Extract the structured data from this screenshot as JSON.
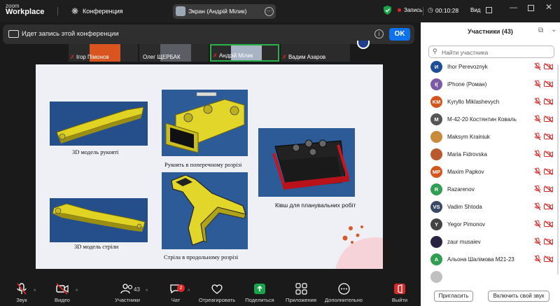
{
  "topbar": {
    "logo_line1": "zoom",
    "logo_line2": "Workplace",
    "conference_label": "Конференция",
    "screen_share_label": "Экран (Андрій Мілик)",
    "record_label": "Запись",
    "timer": "00:10:28",
    "view_label": "Вид"
  },
  "banner": {
    "text": "Идет запись этой конференции",
    "ok_label": "OK"
  },
  "thumbnails": [
    {
      "name": "Ігор Пімонов",
      "muted": true
    },
    {
      "name": "Олег ЩЕРБАК",
      "muted": false
    },
    {
      "name": "Андрій Мілик",
      "muted": true
    },
    {
      "name": "Вадим Азаров",
      "muted": true
    }
  ],
  "slide": {
    "captions": {
      "handle3d": "3D модель рукояті",
      "handle_section": "Рукоять в поперечному розрізі",
      "bucket": "Ківш для планувальних робіт",
      "boom3d": "3D модель стріли",
      "boom_section": "Стріла в продольному розрізі"
    }
  },
  "panel": {
    "title": "Участники (43)",
    "search_placeholder": "Найти участника",
    "invite_label": "Пригласить",
    "unmute_label": "Включить свой звук",
    "participants": [
      {
        "initials": "И",
        "name": "Ihor Perevoznyk",
        "color": "#1f4e99"
      },
      {
        "initials": "I(",
        "name": "iPhone (Роман)",
        "color": "#7a5aa8"
      },
      {
        "initials": "KM",
        "name": "Kyryllo Miklashevych",
        "color": "#d4541e"
      },
      {
        "initials": "M",
        "name": "M-42-20 Костянтин Коваль",
        "color": "#555555"
      },
      {
        "initials": "",
        "name": "Maksym Krainiuk",
        "color": "#c98a3c"
      },
      {
        "initials": "",
        "name": "Maria Fidrovska",
        "color": "#b85a2e"
      },
      {
        "initials": "MP",
        "name": "Maxim Papkov",
        "color": "#d4541e"
      },
      {
        "initials": "R",
        "name": "Razarenov",
        "color": "#2f9e52"
      },
      {
        "initials": "VS",
        "name": "Vadim Shtoda",
        "color": "#3a4a66"
      },
      {
        "initials": "Y",
        "name": "Yegor Pimonov",
        "color": "#444444"
      },
      {
        "initials": "",
        "name": "zaur musaiev",
        "color": "#2a2340"
      },
      {
        "initials": "А",
        "name": "Альона Шалімова М21-23",
        "color": "#2f9e52"
      },
      {
        "initials": "",
        "name": "",
        "color": "#c0c0c0"
      }
    ]
  },
  "toolbar": {
    "audio": "Звук",
    "video": "Видео",
    "participants": "Участники",
    "participants_count": "43",
    "chat": "Чат",
    "chat_badge": "2",
    "react": "Отреагировать",
    "share": "Поделиться",
    "apps": "Приложения",
    "more": "Дополнительно",
    "leave": "Выйти"
  },
  "colors": {
    "accent": "#0e72ed",
    "record": "#e02828",
    "share_green": "#1aa34a"
  }
}
